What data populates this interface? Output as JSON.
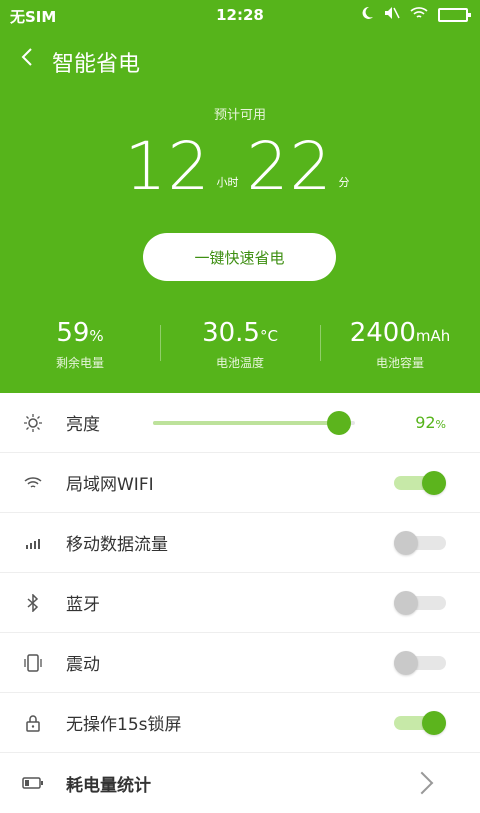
{
  "status_bar": {
    "carrier": "无SIM",
    "time": "12:28"
  },
  "header": {
    "title": "智能省电",
    "predict_label": "预计可用",
    "hours": "12",
    "hours_unit": "小时",
    "minutes": "22",
    "minutes_unit": "分",
    "quick_button": "一键快速省电"
  },
  "stats": [
    {
      "value": "59",
      "unit": "%",
      "label": "剩余电量"
    },
    {
      "value": "30.5",
      "unit": "°C",
      "label": "电池温度"
    },
    {
      "value": "2400",
      "unit": "mAh",
      "label": "电池容量"
    }
  ],
  "settings": {
    "brightness": {
      "label": "亮度",
      "value": "92",
      "unit": "%",
      "level": 0.92
    },
    "wifi": {
      "label": "局域网WIFI",
      "on": true
    },
    "mobile_data": {
      "label": "移动数据流量",
      "on": false
    },
    "bluetooth": {
      "label": "蓝牙",
      "on": false
    },
    "vibrate": {
      "label": "震动",
      "on": false
    },
    "lock": {
      "label": "无操作15s锁屏",
      "on": true
    },
    "usage_stats": {
      "label": "耗电量统计"
    }
  },
  "colors": {
    "primary": "#56b41b",
    "accent": "#5cb41d"
  }
}
